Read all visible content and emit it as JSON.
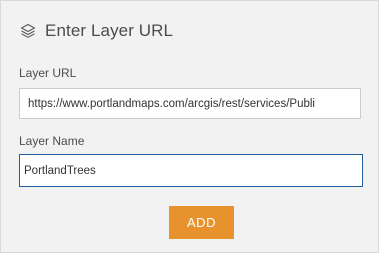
{
  "header": {
    "title": "Enter Layer URL",
    "icon": "layers-icon"
  },
  "form": {
    "url_label": "Layer URL",
    "url_value": "https://www.portlandmaps.com/arcgis/rest/services/Publi",
    "name_label": "Layer Name",
    "name_value": "PortlandTrees"
  },
  "actions": {
    "add_label": "ADD"
  },
  "colors": {
    "accent": "#e8922e",
    "focus_border": "#1f5f9e",
    "background": "#f2f2f2"
  }
}
